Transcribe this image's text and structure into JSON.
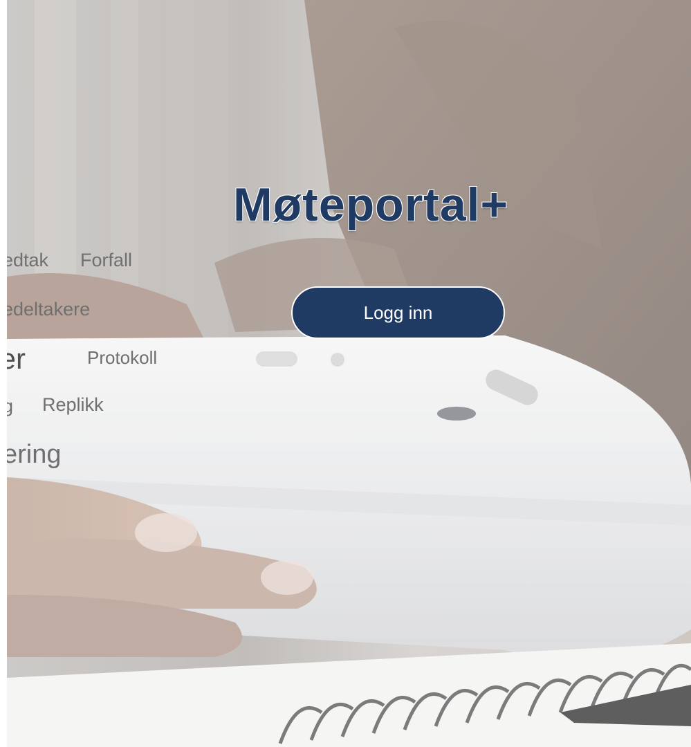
{
  "brand": {
    "name": "Møteportal+"
  },
  "login": {
    "label": "Logg inn"
  },
  "background_words": {
    "w1": "edtak",
    "w2": "Forfall",
    "w3": "edeltakere",
    "w4": "ter",
    "w5": "Protokoll",
    "w6": "g",
    "w7": "Replikk",
    "w8": "ering"
  },
  "colors": {
    "brand": "#1f3a63",
    "button_bg": "#1f3a63",
    "button_text": "#ffffff",
    "words": "#6f6f6f"
  }
}
